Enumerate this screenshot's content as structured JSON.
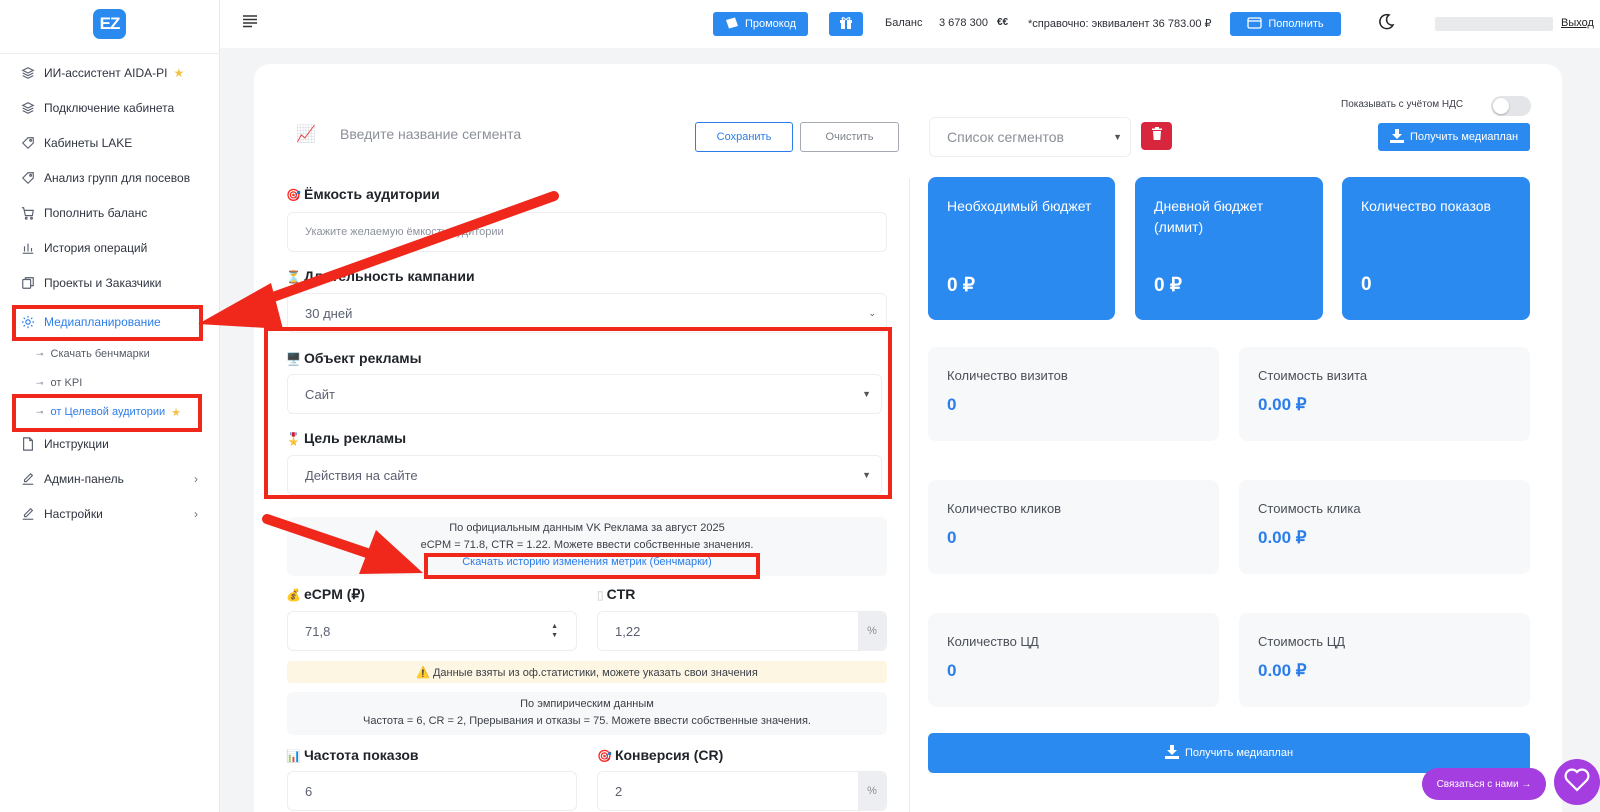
{
  "logo": "EZ",
  "sidebar": {
    "items": [
      {
        "label": "ИИ-ассистент AIDA-PI",
        "icon": "layers-icon",
        "star": "★"
      },
      {
        "label": "Подключение кабинета",
        "icon": "layers-icon"
      },
      {
        "label": "Кабинеты LAKE",
        "icon": "tag-icon"
      },
      {
        "label": "Анализ групп для посевов",
        "icon": "tag-icon"
      },
      {
        "label": "Пополнить баланс",
        "icon": "cart-icon"
      },
      {
        "label": "История операций",
        "icon": "bar-chart-icon"
      },
      {
        "label": "Проекты и Заказчики",
        "icon": "copy-icon"
      },
      {
        "label": "Медиапланирование",
        "icon": "gear-icon"
      },
      {
        "label": "Инструкции",
        "icon": "file-icon"
      },
      {
        "label": "Админ-панель",
        "icon": "edit-icon",
        "chevron": "›"
      },
      {
        "label": "Настройки",
        "icon": "edit-icon",
        "chevron": "›"
      }
    ],
    "subitems": [
      {
        "label": "Скачать бенчмарки"
      },
      {
        "label": "от KPI"
      },
      {
        "label": "от Целевой аудитории",
        "star": "★"
      }
    ]
  },
  "topbar": {
    "promo_label": "Промокод",
    "balance_label": "Баланс",
    "balance_value": "3 678 300",
    "currency_symbol": "€€",
    "equivalent_text": "*справочно: эквивалент 36 783.00 ₽",
    "topup_label": "Пополнить",
    "logout_label": "Выход"
  },
  "segment": {
    "placeholder": "Введите название сегмента",
    "save_label": "Сохранить",
    "clear_label": "Очистить"
  },
  "form": {
    "audience_label": "Ёмкость аудитории",
    "audience_placeholder": "Укажите желаемую ёмкость аудитории",
    "duration_label": "Длительность кампании",
    "duration_value": "30 дней",
    "object_label": "Объект рекламы",
    "object_value": "Сайт",
    "goal_label": "Цель рекламы",
    "goal_value": "Действия на сайте",
    "vk_info_line1": "По официальным данным VK Реклама за август 2025",
    "vk_info_line2": "eCPM = 71.8, CTR = 1.22. Можете ввести собственные значения.",
    "vk_info_link": "Скачать историю изменения метрик (бенчмарки)",
    "ecpm_label": "eCPM (₽)",
    "ecpm_value": "71,8",
    "ctr_label": "CTR",
    "ctr_value": "1,22",
    "percent": "%",
    "warn_text": "⚠️ Данные взяты из оф.статистики, можете указать свои значения",
    "emp_line1": "По эмпирическим данным",
    "emp_line2": "Частота = 6, CR = 2, Прерывания и отказы = 75. Можете ввести собственные значения.",
    "freq_label": "Частота показов",
    "freq_value": "6",
    "cr_label": "Конверсия (CR)",
    "cr_value": "2"
  },
  "right": {
    "vat_label": "Показывать с учётом НДС",
    "vat_enabled": false,
    "segments_placeholder": "Список сегментов",
    "get_plan_label": "Получить медиаплан",
    "blue_tiles": [
      {
        "title": "Необходимый бюджет",
        "value": "0 ₽"
      },
      {
        "title": "Дневной бюджет (лимит)",
        "value": "0 ₽"
      },
      {
        "title": "Количество показов",
        "value": "0"
      }
    ],
    "grey_tiles": [
      {
        "title": "Количество визитов",
        "value": "0"
      },
      {
        "title": "Стоимость визита",
        "value": "0.00 ₽"
      },
      {
        "title": "Количество кликов",
        "value": "0"
      },
      {
        "title": "Стоимость клика",
        "value": "0.00 ₽"
      },
      {
        "title": "Количество ЦД",
        "value": "0"
      },
      {
        "title": "Стоимость ЦД",
        "value": "0.00 ₽"
      }
    ],
    "bottom_plan_label": "Получить медиаплан"
  },
  "contact_label": "Связаться с нами →",
  "colors": {
    "accent": "#2b8af0",
    "annotation": "#f0281c",
    "danger": "#d7263d",
    "chat": "#a53ee0"
  }
}
